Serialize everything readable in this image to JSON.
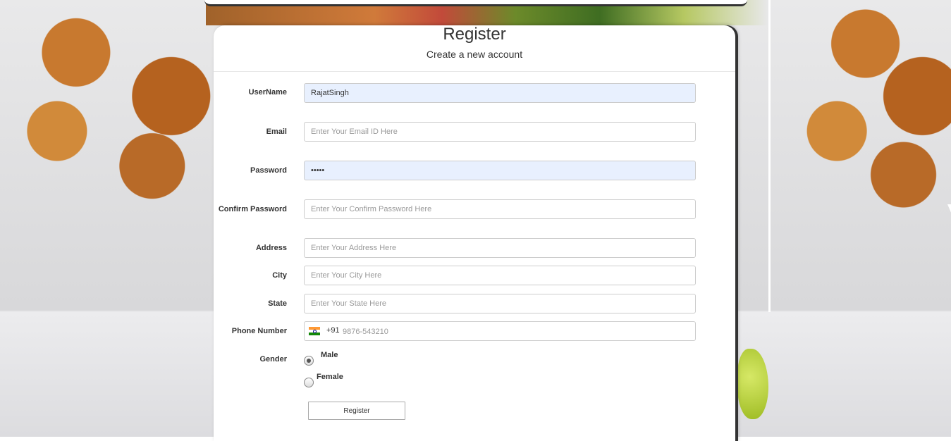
{
  "header": {
    "title": "Register",
    "subtitle": "Create a new account"
  },
  "form": {
    "username": {
      "label": "UserName",
      "value": "RajatSingh",
      "placeholder": ""
    },
    "email": {
      "label": "Email",
      "value": "",
      "placeholder": "Enter Your Email ID Here"
    },
    "password": {
      "label": "Password",
      "value": "•••••",
      "placeholder": ""
    },
    "confirm_password": {
      "label": "Confirm Password",
      "value": "",
      "placeholder": "Enter Your Confirm Password Here"
    },
    "address": {
      "label": "Address",
      "value": "",
      "placeholder": "Enter Your Address Here"
    },
    "city": {
      "label": "City",
      "value": "",
      "placeholder": "Enter Your City Here"
    },
    "state": {
      "label": "State",
      "value": "",
      "placeholder": "Enter Your State Here"
    },
    "phone": {
      "label": "Phone Number",
      "dial_code": "+91",
      "flag_icon": "india-flag-icon",
      "value": "",
      "placeholder": "9876-543210"
    },
    "gender": {
      "label": "Gender",
      "options": [
        {
          "label": "Male",
          "checked": true
        },
        {
          "label": "Female",
          "checked": false
        }
      ]
    },
    "submit_label": "Register"
  },
  "colors": {
    "autofill_bg": "#e8f0fe",
    "panel_bg": "#ffffff",
    "text": "#333333"
  }
}
